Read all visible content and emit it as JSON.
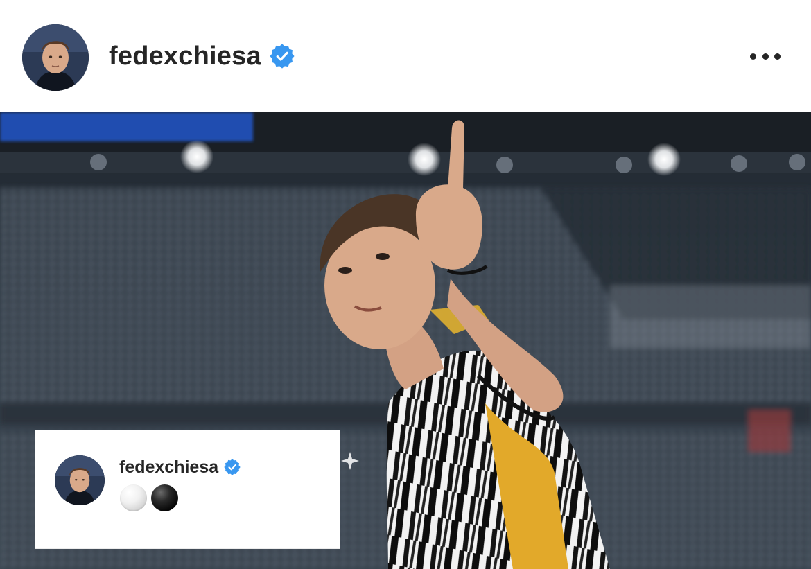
{
  "post": {
    "username": "fedexchiesa",
    "verified": true,
    "verified_icon": "verified-badge-icon",
    "more_icon": "more-options-icon",
    "avatar_icon": "profile-avatar",
    "photo_subject": "photo"
  },
  "comment": {
    "username": "fedexchiesa",
    "verified": true,
    "emojis": [
      "white-circle",
      "black-circle"
    ]
  },
  "colors": {
    "text": "#262626",
    "verified_blue": "#3897f0",
    "background": "#ffffff"
  }
}
